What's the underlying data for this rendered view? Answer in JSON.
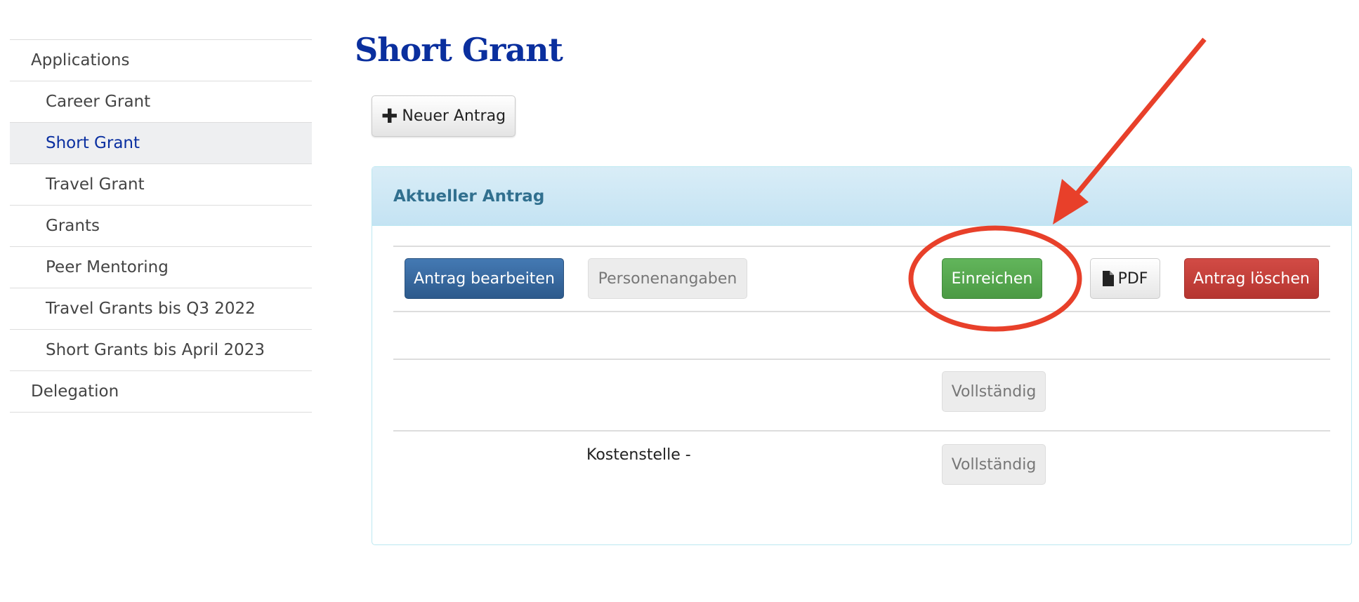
{
  "sidebar": {
    "items": [
      {
        "label": "Applications",
        "level": 0
      },
      {
        "label": "Career Grant",
        "level": 1
      },
      {
        "label": "Short Grant",
        "level": 1,
        "active": true
      },
      {
        "label": "Travel Grant",
        "level": 1
      },
      {
        "label": "Grants",
        "level": 1
      },
      {
        "label": "Peer Mentoring",
        "level": 1
      },
      {
        "label": "Travel Grants bis Q3 2022",
        "level": 1
      },
      {
        "label": "Short Grants bis April 2023",
        "level": 1
      },
      {
        "label": "Delegation",
        "level": 0
      }
    ]
  },
  "page": {
    "title": "Short Grant",
    "new_button": "Neuer Antrag",
    "new_icon": "plus-icon"
  },
  "panel": {
    "title": "Aktueller Antrag",
    "buttons": {
      "edit": "Antrag bearbeiten",
      "persons": "Personenangaben",
      "submit": "Einreichen",
      "pdf": "PDF",
      "delete": "Antrag löschen"
    },
    "rows": [
      {
        "label": "",
        "status": "Vollständig"
      },
      {
        "label": "Kostenstelle -",
        "status": "Vollständig"
      }
    ]
  },
  "colors": {
    "title": "#0a2f9e",
    "edit": "#2d5a8c",
    "submit": "#4b9a44",
    "delete": "#b53530",
    "annotation": "#e8402a"
  }
}
